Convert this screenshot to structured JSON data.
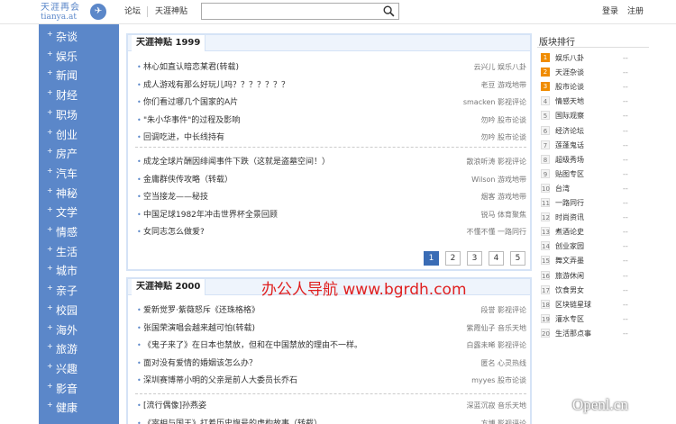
{
  "brand": {
    "logo_line1": "天涯再会",
    "logo_line2": "tianya.at"
  },
  "nav": {
    "forum": "论坛",
    "hot_posts": "天涯神贴",
    "login": "登录",
    "register": "注册"
  },
  "search": {
    "value": "",
    "placeholder": ""
  },
  "sidebar": {
    "items": [
      "杂谈",
      "娱乐",
      "新闻",
      "财经",
      "职场",
      "创业",
      "房产",
      "汽车",
      "神秘",
      "文学",
      "情感",
      "生活",
      "城市",
      "亲子",
      "校园",
      "海外",
      "旅游",
      "兴趣",
      "影音",
      "健康"
    ]
  },
  "panel1": {
    "title": "天涯神贴 1999",
    "group1": [
      {
        "title": "林心如直认暗恋某君(转载)",
        "meta": "云兴儿 娱乐八卦"
      },
      {
        "title": "成人游戏有那么好玩儿吗？？？？？？？",
        "meta": "老豆 游戏地带"
      },
      {
        "title": "你们看过哪几个国家的A片",
        "meta": "smacken 影视评论"
      },
      {
        "title": "\"朱小华事件\"的过程及影响",
        "meta": "勿吟 股市论谈"
      },
      {
        "title": "回调吃进，中长线持有",
        "meta": "勿吟 股市论谈"
      }
    ],
    "group2": [
      {
        "title": "成龙全球片酬因绯闻事件下跌（这就是盗墓空间！）",
        "meta": "散浪听涛 影视评论"
      },
      {
        "title": "金庸群侠传攻略（转载）",
        "meta": "Wilson 游戏地带"
      },
      {
        "title": "空当接龙——秘技",
        "meta": "烟客 游戏地带"
      },
      {
        "title": "中国足球1982年冲击世界杯全景回顾",
        "meta": "锐马 体育聚焦"
      },
      {
        "title": "女同志怎么做爱?",
        "meta": "不懂不懂 一路同行"
      }
    ],
    "pages": [
      "1",
      "2",
      "3",
      "4",
      "5"
    ],
    "active_page": "1"
  },
  "panel2": {
    "title": "天涯神贴 2000",
    "group1": [
      {
        "title": "爱新觉罗·紫薇怒斥《还珠格格》",
        "meta": "段誉 影视评论"
      },
      {
        "title": "张国荣演唱会越来越可怕(转载)",
        "meta": "紫霞仙子 音乐天地"
      },
      {
        "title": "《鬼子来了》在日本也禁放，但和在中国禁放的理由不一样。",
        "meta": "白露未晞 影视评论"
      },
      {
        "title": "面对没有爱情的婚姻该怎么办？",
        "meta": "匿名 心灵热线"
      },
      {
        "title": "深圳赛博蒂小明的父亲是前人大委员长乔石",
        "meta": "myyes 股市论谈"
      }
    ],
    "group2": [
      {
        "title": "[流行偶像]孙燕姿",
        "meta": "深蓝沉寂 音乐天地"
      },
      {
        "title": "《宰相与国王》打着历史旗号的虚构故事（转载）",
        "meta": "方博 影视评论"
      }
    ]
  },
  "ranking": {
    "title": "版块排行",
    "items": [
      {
        "num": "1",
        "name": "娱乐八卦",
        "value": "--"
      },
      {
        "num": "2",
        "name": "天涯杂谈",
        "value": "--"
      },
      {
        "num": "3",
        "name": "股市论谈",
        "value": "--"
      },
      {
        "num": "4",
        "name": "情感天地",
        "value": "--"
      },
      {
        "num": "5",
        "name": "国际观察",
        "value": "--"
      },
      {
        "num": "6",
        "name": "经济论坛",
        "value": "--"
      },
      {
        "num": "7",
        "name": "莲蓬鬼话",
        "value": "--"
      },
      {
        "num": "8",
        "name": "超级秀场",
        "value": "--"
      },
      {
        "num": "9",
        "name": "贴图专区",
        "value": "--"
      },
      {
        "num": "10",
        "name": "台湾",
        "value": "--"
      },
      {
        "num": "11",
        "name": "一路同行",
        "value": "--"
      },
      {
        "num": "12",
        "name": "时尚资讯",
        "value": "--"
      },
      {
        "num": "13",
        "name": "煮酒论史",
        "value": "--"
      },
      {
        "num": "14",
        "name": "创业家园",
        "value": "--"
      },
      {
        "num": "15",
        "name": "舞文弄墨",
        "value": "--"
      },
      {
        "num": "16",
        "name": "旅游休闲",
        "value": "--"
      },
      {
        "num": "17",
        "name": "饮食男女",
        "value": "--"
      },
      {
        "num": "18",
        "name": "区块链星球",
        "value": "--"
      },
      {
        "num": "19",
        "name": "灌水专区",
        "value": "--"
      },
      {
        "num": "20",
        "name": "生活那点事",
        "value": "--"
      }
    ]
  },
  "watermarks": {
    "center": "办公人导航  www.bgrdh.com",
    "corner": "Openl.cn"
  },
  "colors": {
    "sidebar": "#5b87c9",
    "accent": "#3a6cb5",
    "rank1": "#f08c00",
    "rank2": "#f08c00",
    "rank3": "#f08c00",
    "watermark": "#e02020"
  },
  "icons": {
    "search": "search-icon",
    "logo": "globe-icon"
  }
}
